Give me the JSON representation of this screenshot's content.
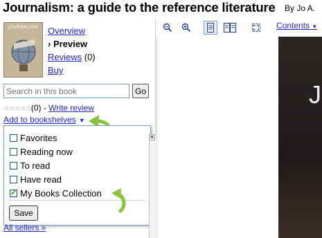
{
  "header": {
    "title": "Journalism: a guide to the reference literature",
    "author": "By Jo A."
  },
  "cover": {
    "title_text": "JOURNALISM"
  },
  "nav": {
    "overview": "Overview",
    "preview": "› Preview",
    "reviews": "Reviews",
    "reviews_count": "(0)",
    "buy": "Buy"
  },
  "search": {
    "placeholder": "Search in this book",
    "go_label": "Go"
  },
  "reviews_row": {
    "stars": "☆☆☆☆☆",
    "count": "(0) - ",
    "write_review": "Write review"
  },
  "shelves": {
    "label": "Add to bookshelves",
    "arrow": "▼"
  },
  "popup": {
    "items": [
      {
        "label": "Favorites",
        "checked": false
      },
      {
        "label": "Reading now",
        "checked": false
      },
      {
        "label": "To read",
        "checked": false
      },
      {
        "label": "Have read",
        "checked": false
      },
      {
        "label": "My Books Collection",
        "checked": true
      }
    ],
    "save_label": "Save"
  },
  "sellers": {
    "label": "All sellers »"
  },
  "toolbar": {
    "icons": [
      "zoom-out-icon",
      "zoom-in-icon",
      "one-page-icon",
      "two-page-icon",
      "fullscreen-icon"
    ],
    "contents_label": "Contents",
    "contents_arrow": "▼"
  },
  "viewer": {
    "visible_letter": "J"
  },
  "colors": {
    "link": "#1e26c9",
    "popup_border": "#7a9cd3",
    "check": "#21a121",
    "annotation_arrow": "#8ac43a"
  }
}
